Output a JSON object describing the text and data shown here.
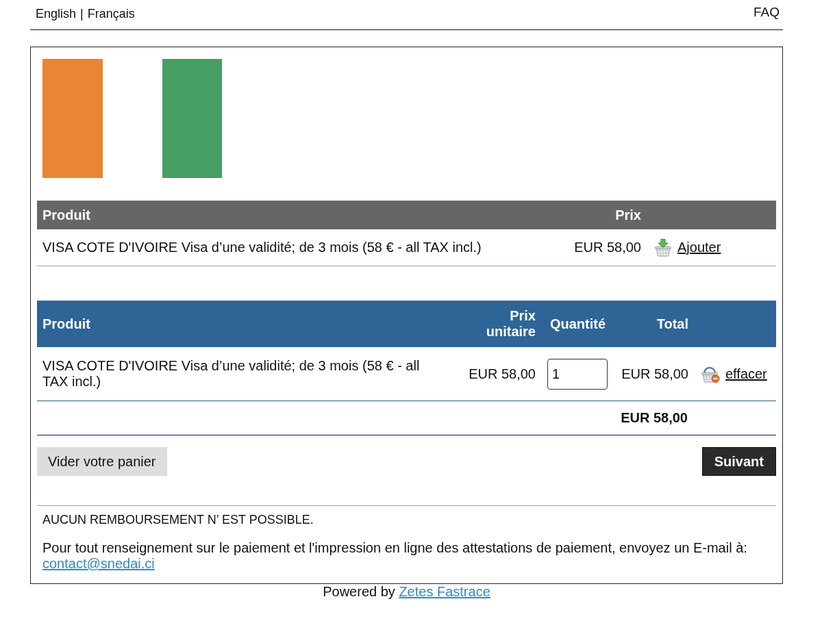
{
  "top_bar": {
    "languages": [
      "English",
      "Français"
    ],
    "separator": "|",
    "faq": "FAQ"
  },
  "catalog": {
    "columns": [
      "Produit",
      "Prix"
    ],
    "rows": [
      {
        "product": "VISA COTE D'IVOIRE Visa d’une validité; de 3 mois (58 € - all TAX incl.)",
        "price": "EUR 58,00",
        "action": "Ajouter"
      }
    ]
  },
  "cart": {
    "columns": [
      "Produit",
      "Prix unitaire",
      "Quantité",
      "Total"
    ],
    "rows": [
      {
        "product": "VISA COTE D'IVOIRE Visa d’une validité; de 3 mois (58 € - all TAX incl.)",
        "unit_price": "EUR 58,00",
        "quantity": "1",
        "total": "EUR 58,00",
        "action": "effacer"
      }
    ],
    "grand_total": "EUR 58,00"
  },
  "buttons": {
    "clear": "Vider votre panier",
    "next": "Suivant"
  },
  "notice": "AUCUN REMBOURSEMENT N’ EST POSSIBLE.",
  "contact": {
    "text": "Pour tout renseignement sur le paiement et l'impression en ligne des attestations de paiement, envoyez un E-mail à:",
    "email": "contact@snedai.ci"
  },
  "footer": {
    "text": "Powered by",
    "link": "Zetes Fastrace"
  }
}
